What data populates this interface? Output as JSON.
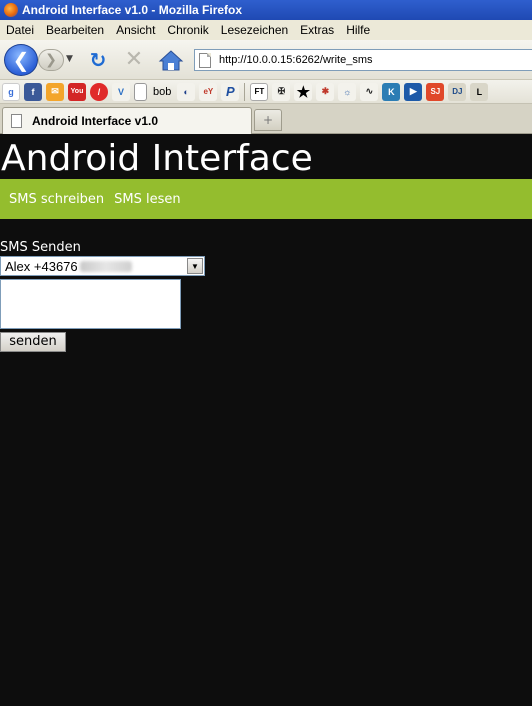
{
  "window": {
    "title": "Android Interface v1.0 - Mozilla Firefox"
  },
  "menu": {
    "items": [
      "Datei",
      "Bearbeiten",
      "Ansicht",
      "Chronik",
      "Lesezeichen",
      "Extras",
      "Hilfe"
    ]
  },
  "navbar": {
    "url": "http://10.0.0.15:6262/write_sms",
    "icons": [
      "back-icon",
      "forward-icon",
      "reload-icon",
      "stop-icon",
      "home-icon"
    ]
  },
  "bookmarks": {
    "label_bob": "bob",
    "icons": [
      "google-icon",
      "facebook-icon",
      "mail-icon",
      "youtube-icon",
      "no-entry-icon",
      "v-icon",
      "page-icon",
      "bob",
      "turtle-icon",
      "ebay-icon",
      "paypal-icon",
      "ft-icon",
      "bird-icon",
      "star-icon",
      "flame-icon",
      "chat-icon",
      "signature-icon",
      "k-icon",
      "play-icon",
      "sj-icon",
      "dj-icon",
      "l-icon"
    ]
  },
  "tabs": {
    "active_label": "Android Interface v1.0",
    "new_tab_symbol": "+"
  },
  "site": {
    "title": "Android Interface",
    "nav": {
      "write_sms": "SMS schreiben",
      "read_sms": "SMS lesen"
    },
    "form": {
      "label": "SMS Senden",
      "recipient_visible": "Alex +43676",
      "message_value": "",
      "send_label": "senden"
    }
  },
  "colors": {
    "page_background": "#0d0d0d",
    "nav_band": "#94bd2e",
    "titlebar": "#2f5fce"
  }
}
